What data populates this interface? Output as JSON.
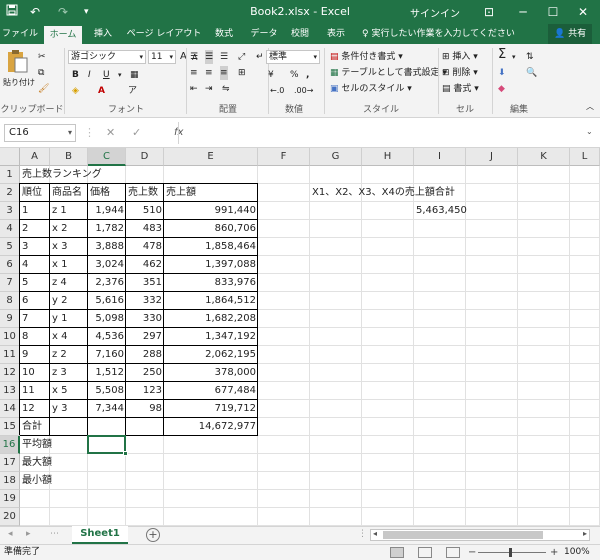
{
  "titlebar": {
    "save_icon": "save-icon",
    "undo": "↶",
    "redo": "↷",
    "title": "Book2.xlsx  -  Excel",
    "signin": "サインイン",
    "minimize": "─",
    "maximize": "☐",
    "close": "✕",
    "ribbon_opts": "⊡"
  },
  "tabs": [
    "ファイル",
    "ホーム",
    "挿入",
    "ページ レイアウト",
    "数式",
    "データ",
    "校閲",
    "表示"
  ],
  "active_tab": "ホーム",
  "tellme": "♀ 実行したい作業を入力してください",
  "share": "👤 共有",
  "ribbon": {
    "clipboard": {
      "paste": "貼り付け",
      "label": "クリップボード"
    },
    "font": {
      "name": "游ゴシック",
      "size": "11",
      "bold": "B",
      "italic": "I",
      "underline": "U",
      "grow": "A",
      "shrink": "A",
      "label": "フォント",
      "furigana": "ア"
    },
    "alignment": {
      "label": "配置"
    },
    "number": {
      "format": "標準",
      "percent": "%",
      "comma": ",",
      "label": "数値",
      "currency": "¥"
    },
    "styles": {
      "conditional": "条件付き書式",
      "table": "テーブルとして書式設定",
      "cell": "セルのスタイル",
      "label": "スタイル"
    },
    "cells": {
      "insert": "挿入",
      "delete": "削除",
      "format": "書式",
      "label": "セル"
    },
    "editing": {
      "label": "編集",
      "sum": "Σ"
    }
  },
  "formula_bar": {
    "name_box": "C16",
    "cancel": "✕",
    "enter": "✓",
    "fx": "fx",
    "value": ""
  },
  "columns": [
    "A",
    "B",
    "C",
    "D",
    "E",
    "F",
    "G",
    "H",
    "I",
    "J",
    "K",
    "L"
  ],
  "selected_col": "C",
  "rows": [
    "1",
    "2",
    "3",
    "4",
    "5",
    "6",
    "7",
    "8",
    "9",
    "10",
    "11",
    "12",
    "13",
    "14",
    "15",
    "16",
    "17",
    "18",
    "19",
    "20"
  ],
  "selected_row": "16",
  "cells": {
    "A1": "売上数ランキング",
    "A2": "順位",
    "B2": "商品名",
    "C2": "価格",
    "D2": "売上数",
    "E2": "売上額",
    "G2": "X1、X2、X3、X4の売上額合計",
    "A3": "1",
    "B3": "z 1",
    "C3": "1,944",
    "D3": "510",
    "E3": "991,440",
    "I3": "5,463,450",
    "A4": "2",
    "B4": "x 2",
    "C4": "1,782",
    "D4": "483",
    "E4": "860,706",
    "A5": "3",
    "B5": "x 3",
    "C5": "3,888",
    "D5": "478",
    "E5": "1,858,464",
    "A6": "4",
    "B6": "x 1",
    "C6": "3,024",
    "D6": "462",
    "E6": "1,397,088",
    "A7": "5",
    "B7": "z 4",
    "C7": "2,376",
    "D7": "351",
    "E7": "833,976",
    "A8": "6",
    "B8": "y 2",
    "C8": "5,616",
    "D8": "332",
    "E8": "1,864,512",
    "A9": "7",
    "B9": "y 1",
    "C9": "5,098",
    "D9": "330",
    "E9": "1,682,208",
    "A10": "8",
    "B10": "x 4",
    "C10": "4,536",
    "D10": "297",
    "E10": "1,347,192",
    "A11": "9",
    "B11": "z 2",
    "C11": "7,160",
    "D11": "288",
    "E11": "2,062,195",
    "A12": "10",
    "B12": "z 3",
    "C12": "1,512",
    "D12": "250",
    "E12": "378,000",
    "A13": "11",
    "B13": "x 5",
    "C13": "5,508",
    "D13": "123",
    "E13": "677,484",
    "A14": "12",
    "B14": "y 3",
    "C14": "7,344",
    "D14": "98",
    "E14": "719,712",
    "A15": "合計",
    "E15": "14,672,977",
    "A16": "平均額",
    "A17": "最大額",
    "A18": "最小額"
  },
  "active_cell": "C16",
  "sheet_tab": "Sheet1",
  "add_sheet": "+",
  "status": "準備完了",
  "zoom": "100%",
  "zoom_minus": "−",
  "zoom_plus": "+"
}
